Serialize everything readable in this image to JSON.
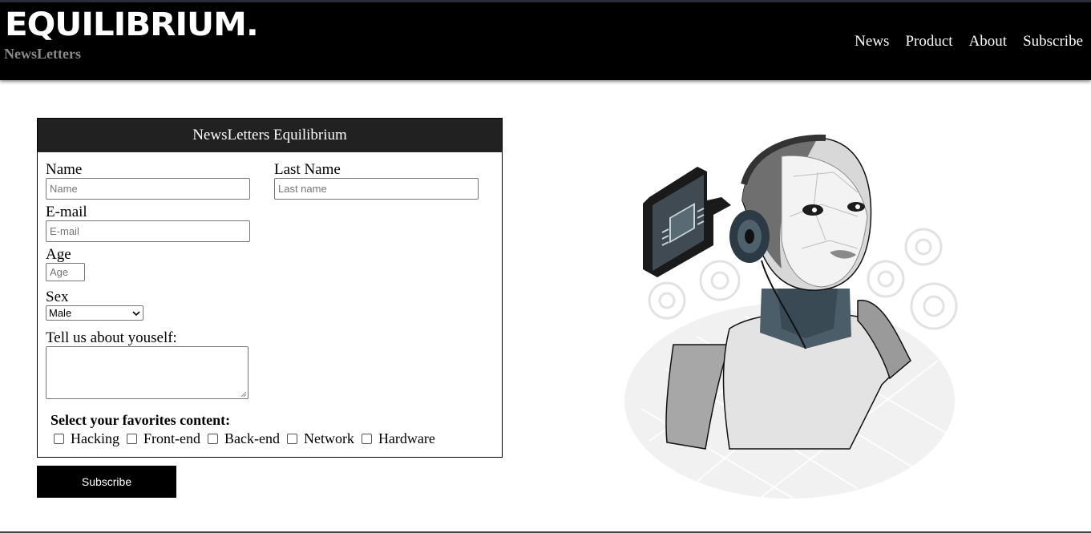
{
  "header": {
    "brand": "EQUILIBRIUM.",
    "tagline": "NewsLetters",
    "nav": [
      "News",
      "Product",
      "About",
      "Subscribe"
    ]
  },
  "form": {
    "title": "NewsLetters Equilibrium",
    "name": {
      "label": "Name",
      "placeholder": "Name"
    },
    "last_name": {
      "label": "Last Name",
      "placeholder": "Last name"
    },
    "email": {
      "label": "E-mail",
      "placeholder": "E-mail"
    },
    "age": {
      "label": "Age",
      "placeholder": "Age"
    },
    "sex": {
      "label": "Sex",
      "selected": "Male"
    },
    "about": {
      "label": "Tell us about youself:"
    },
    "favorites": {
      "title": "Select your favorites content:",
      "options": [
        "Hacking",
        "Front-end",
        "Back-end",
        "Network",
        "Hardware"
      ]
    },
    "submit_label": "Subscribe"
  },
  "illustration": {
    "icon": "robot-with-headphones-illustration"
  },
  "colors": {
    "header_bg": "#000000",
    "form_header_bg": "#212121",
    "button_bg": "#000000"
  }
}
